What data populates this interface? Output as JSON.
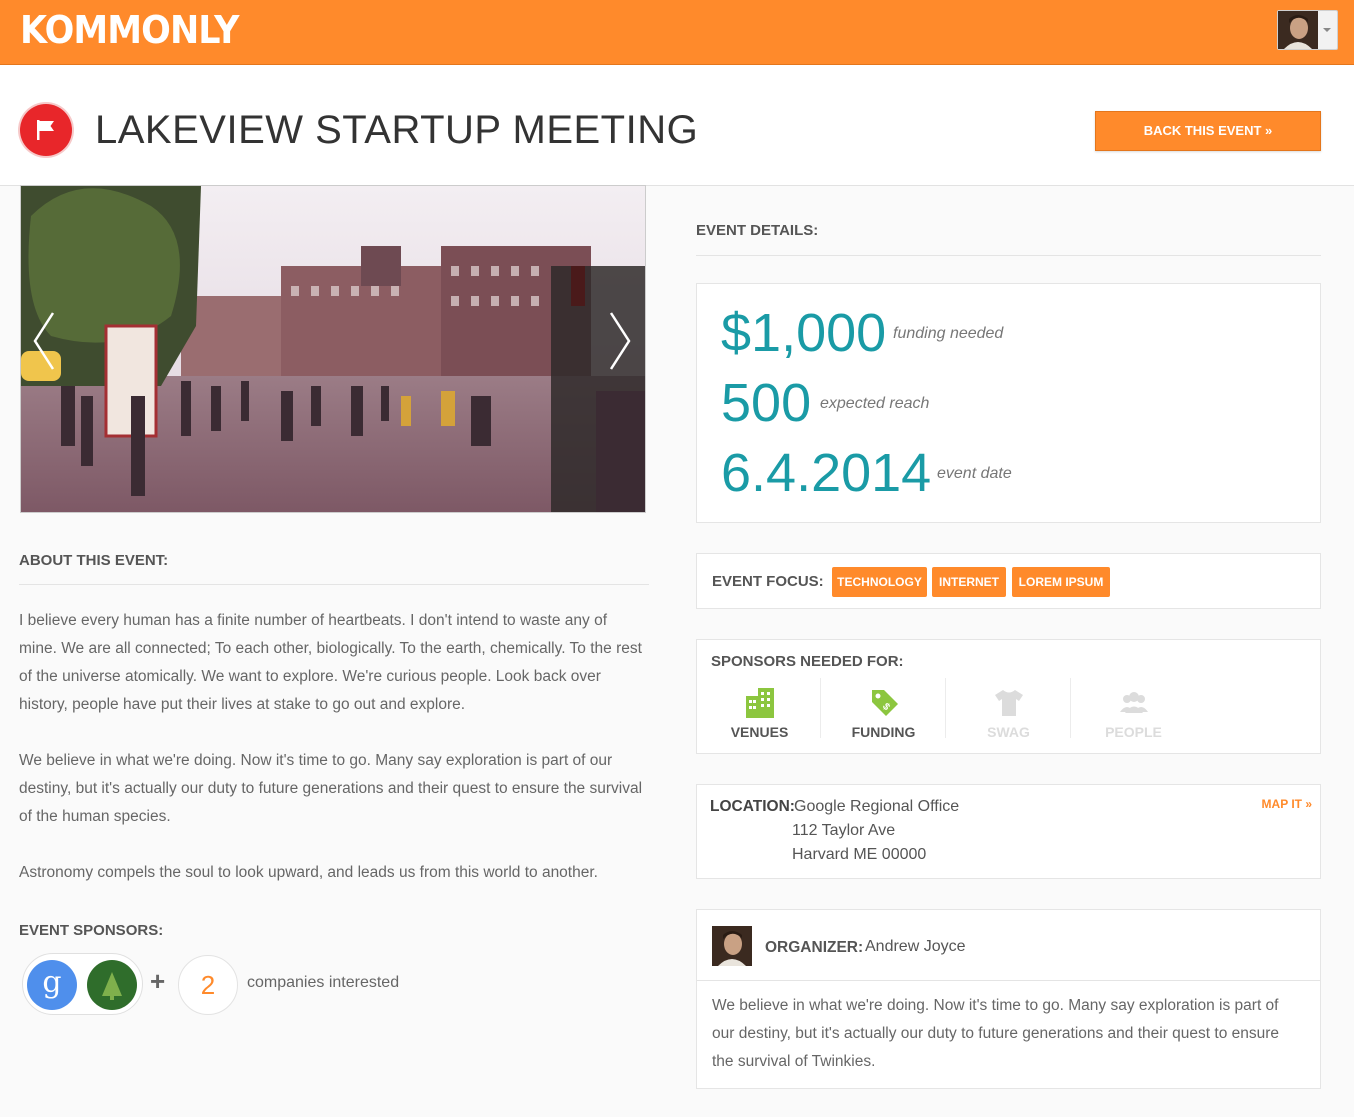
{
  "header": {
    "brand": "KOMMONLY",
    "user_menu": {
      "avatar_icon": "user-avatar"
    }
  },
  "event": {
    "title": "LAKEVIEW STARTUP MEETING",
    "icon": "flag-icon",
    "back_button": "BACK THIS EVENT »"
  },
  "about": {
    "heading": "ABOUT THIS EVENT:",
    "paragraphs": [
      "I believe every human has a finite number of heartbeats. I don't intend to waste any of mine. We are all connected; To each other, biologically. To the earth, chemically. To the rest of the universe atomically. We want to explore. We're curious people. Look back over history, people have put their lives at stake to go out and explore.",
      "We believe in what we're doing. Now it's time to go. Many say exploration is part of our destiny, but it's actually our duty to future generations and their quest to ensure the survival of the human species.",
      "Astronomy compels the soul to look upward, and leads us from this world to another."
    ]
  },
  "sponsors": {
    "heading": "EVENT SPONSORS:",
    "logos": [
      "google-logo",
      "tree-logo"
    ],
    "plus": "+",
    "count": "2",
    "count_label": "companies interested"
  },
  "details": {
    "heading": "EVENT DETAILS:",
    "funding": {
      "value": "$1,000",
      "label": "funding needed"
    },
    "reach": {
      "value": "500",
      "label": "expected reach"
    },
    "date": {
      "value": "6.4.2014",
      "label": "event date"
    }
  },
  "focus": {
    "label": "EVENT FOCUS:",
    "tags": [
      "TECHNOLOGY",
      "INTERNET",
      "LOREM IPSUM"
    ]
  },
  "sponsors_needed": {
    "heading": "SPONSORS NEEDED FOR:",
    "items": [
      {
        "label": "VENUES",
        "icon": "building-icon",
        "active": true
      },
      {
        "label": "FUNDING",
        "icon": "price-tag-icon",
        "active": true
      },
      {
        "label": "SWAG",
        "icon": "tshirt-icon",
        "active": false
      },
      {
        "label": "PEOPLE",
        "icon": "people-icon",
        "active": false
      }
    ]
  },
  "location": {
    "label": "LOCATION:",
    "lines": [
      "Google Regional Office",
      "112 Taylor Ave",
      "Harvard ME 00000"
    ],
    "map_link": "MAP IT »"
  },
  "organizer": {
    "label": "ORGANIZER:",
    "name": "Andrew Joyce",
    "bio": "We believe in what we're doing. Now it's time to go. Many say exploration is part of our destiny, but it's actually our duty to future generations and their quest to ensure the survival of Twinkies."
  },
  "colors": {
    "brand_orange": "#ff8a2b",
    "stat_teal": "#1a9ba6",
    "flag_red": "#e8262a",
    "active_green": "#8cc63f",
    "inactive_gray": "#d8d8d8"
  }
}
